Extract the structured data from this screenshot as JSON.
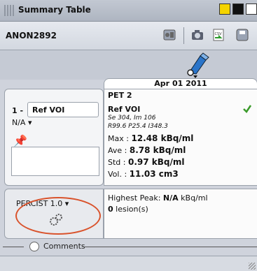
{
  "window": {
    "title": "Summary Table"
  },
  "toolbar": {
    "patient_id": "ANON2892",
    "icons": [
      "layout-icon",
      "camera-icon",
      "csv-export-icon",
      "save-icon"
    ]
  },
  "date": "Apr 01 2011",
  "voi": {
    "index_prefix": "1 -",
    "name": "Ref VOI",
    "na_label": "N/A"
  },
  "series": {
    "name": "PET 2",
    "voi_name": "Ref VOI",
    "slice_info": "Se 304, Im 106",
    "coords": "R99.6 P25.4 I348.3",
    "max_label": "Max :",
    "max_value": "12.48 kBq/ml",
    "ave_label": "Ave :",
    "ave_value": "8.78 kBq/ml",
    "std_label": "Std :",
    "std_value": "0.97 kBq/ml",
    "vol_label": "Vol. :",
    "vol_value": "11.03 cm3"
  },
  "percist": {
    "label": "PERCIST 1.0",
    "highest_peak_label": "Highest Peak:",
    "highest_peak_value": "N/A",
    "highest_peak_unit": "kBq/ml",
    "lesion_count": "0",
    "lesion_label": "lesion(s)"
  },
  "comments": {
    "label": "Comments"
  },
  "colors": {
    "highlight_oval": "#d9532c",
    "check_green": "#3a9a2a"
  }
}
